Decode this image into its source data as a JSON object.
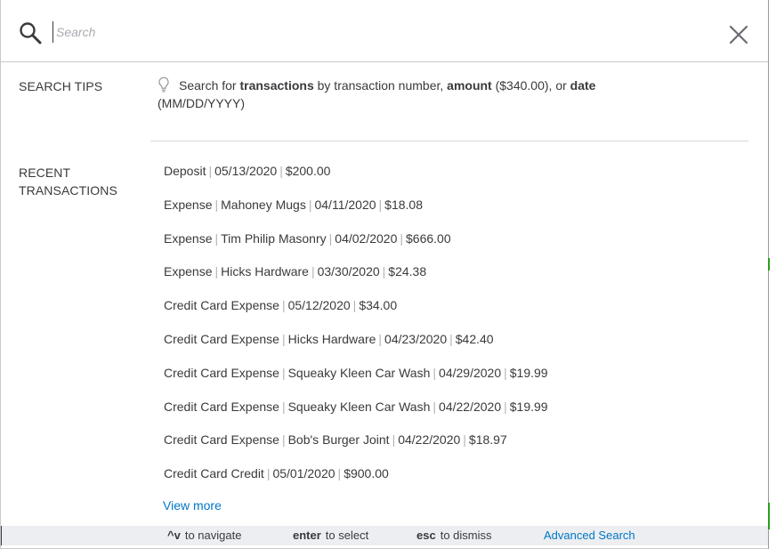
{
  "search": {
    "placeholder": "Search",
    "value": ""
  },
  "tips": {
    "label": "SEARCH TIPS",
    "text_1": "Search for ",
    "bold_1": "transactions",
    "text_2": " by transaction number, ",
    "bold_2": "amount",
    "text_3": " ($340.00), or ",
    "bold_3": "date",
    "text_4": " (MM/DD/YYYY)"
  },
  "recent": {
    "label": "RECENT TRANSACTIONS",
    "items": [
      [
        "Deposit",
        "05/13/2020",
        "$200.00"
      ],
      [
        "Expense",
        "Mahoney Mugs",
        "04/11/2020",
        "$18.08"
      ],
      [
        "Expense",
        "Tim Philip Masonry",
        "04/02/2020",
        "$666.00"
      ],
      [
        "Expense",
        "Hicks Hardware",
        "03/30/2020",
        "$24.38"
      ],
      [
        "Credit Card Expense",
        "05/12/2020",
        "$34.00"
      ],
      [
        "Credit Card Expense",
        "Hicks Hardware",
        "04/23/2020",
        "$42.40"
      ],
      [
        "Credit Card Expense",
        "Squeaky Kleen Car Wash",
        "04/29/2020",
        "$19.99"
      ],
      [
        "Credit Card Expense",
        "Squeaky Kleen Car Wash",
        "04/22/2020",
        "$19.99"
      ],
      [
        "Credit Card Expense",
        "Bob's Burger Joint",
        "04/22/2020",
        "$18.97"
      ],
      [
        "Credit Card Credit",
        "05/01/2020",
        "$900.00"
      ]
    ],
    "view_more": "View more"
  },
  "footer": {
    "navigate_key": "^v",
    "navigate_text": "to navigate",
    "select_key": "enter",
    "select_text": "to select",
    "dismiss_key": "esc",
    "dismiss_text": "to dismiss",
    "advanced": "Advanced Search"
  },
  "icons": {
    "search": "search-icon",
    "close": "close-icon",
    "tip": "lightbulb-icon"
  },
  "colors": {
    "link": "#0077c5",
    "text": "#393a3d",
    "footer_bg": "#eceef1",
    "accent_green": "#2ca01c"
  }
}
